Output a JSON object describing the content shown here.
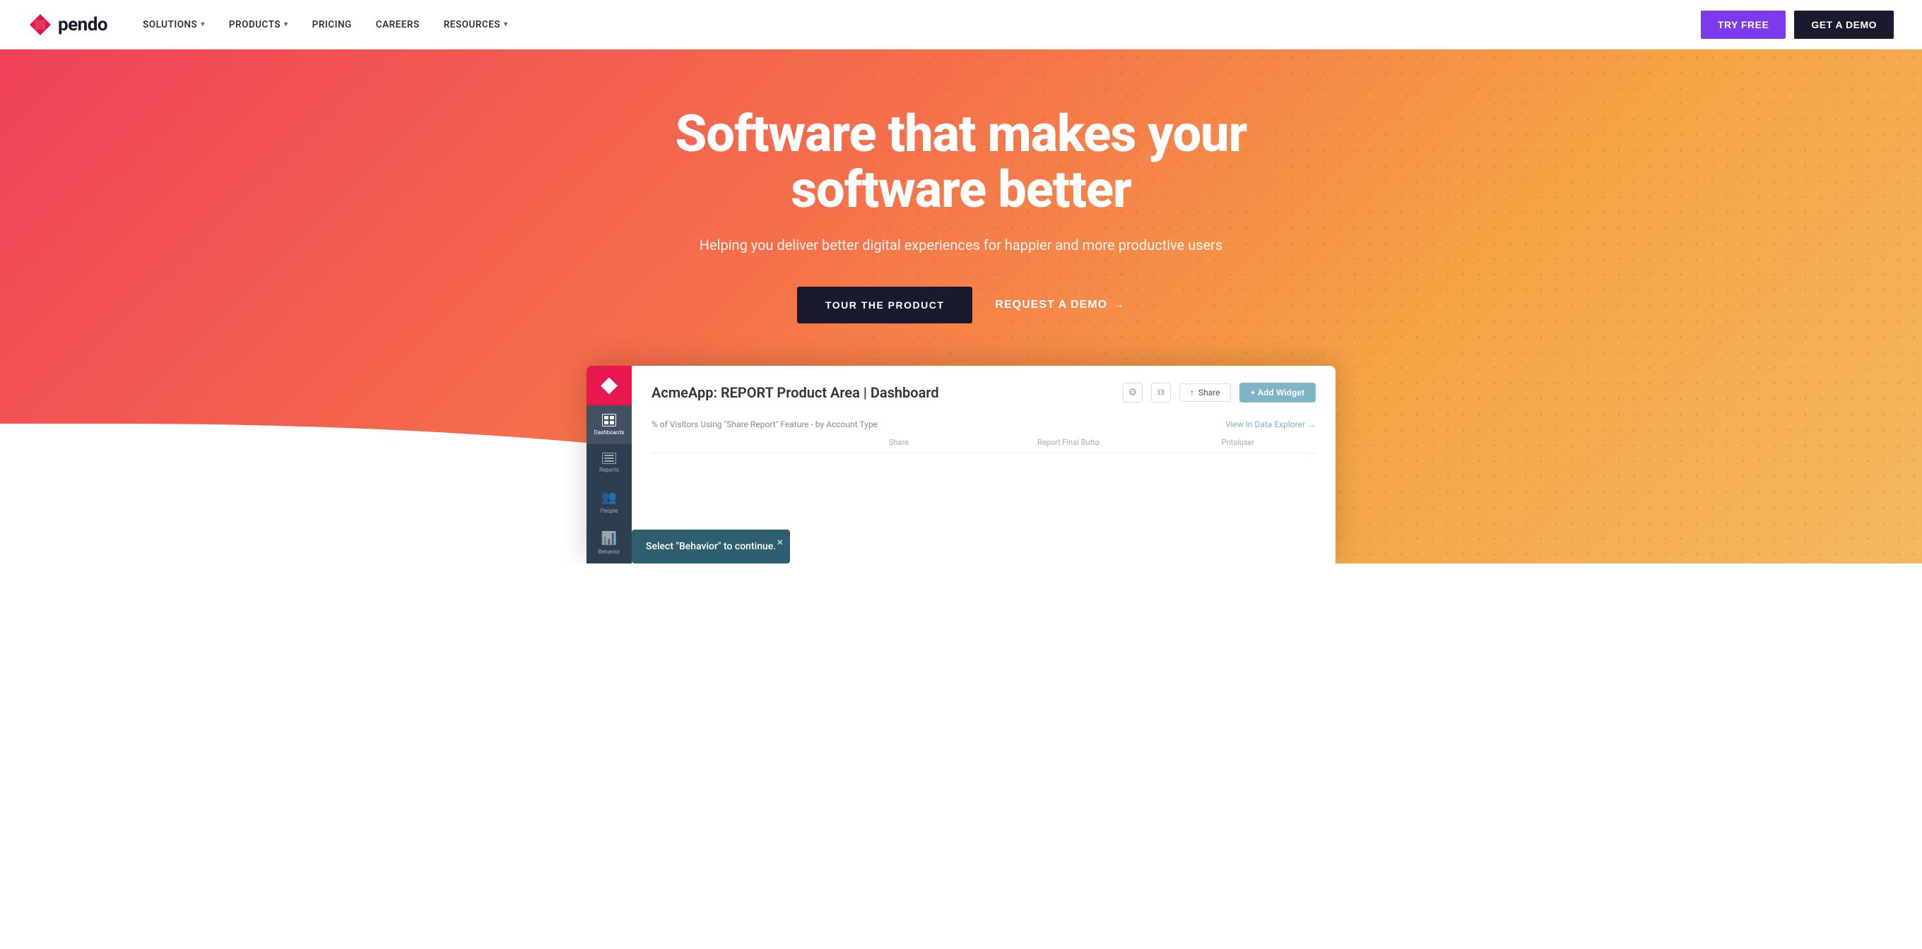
{
  "nav": {
    "logo_text": "pendo",
    "links": [
      {
        "label": "SOLUTIONS",
        "has_dropdown": true
      },
      {
        "label": "PRODUCTS",
        "has_dropdown": true
      },
      {
        "label": "PRICING",
        "has_dropdown": false
      },
      {
        "label": "CAREERS",
        "has_dropdown": false
      },
      {
        "label": "RESOURCES",
        "has_dropdown": true
      }
    ],
    "try_free": "TRY FREE",
    "get_a_demo": "GET A DEMO"
  },
  "hero": {
    "headline_line1": "Software that makes your",
    "headline_line2": "software better",
    "subheadline": "Helping you deliver better digital experiences for happier and more productive users",
    "cta_primary": "TOUR THE PRODUCT",
    "cta_secondary": "REQUEST A DEMO",
    "cta_arrow": "→"
  },
  "dashboard": {
    "title": "AcmeApp: REPORT Product Area | Dashboard",
    "chart_label": "% of Visitors Using \"Share Report\" Feature - by Account Type",
    "chart_link": "View in Data Explorer →",
    "table_cols": [
      "",
      "Share",
      "Report Final Butto",
      "Potaluser"
    ],
    "share_label": "Share",
    "add_widget_label": "+ Add Widget",
    "settings_icon": "⚙",
    "copy_icon": "⧉",
    "tooltip_text": "Select \"Behavior\" to continue.",
    "tooltip_close": "×"
  },
  "sidebar_items": [
    {
      "label": "Dashboards",
      "icon": "grid"
    },
    {
      "label": "Reports",
      "icon": "table"
    },
    {
      "label": "People",
      "icon": "users"
    },
    {
      "label": "Behavior",
      "icon": "activity",
      "active": true
    }
  ]
}
